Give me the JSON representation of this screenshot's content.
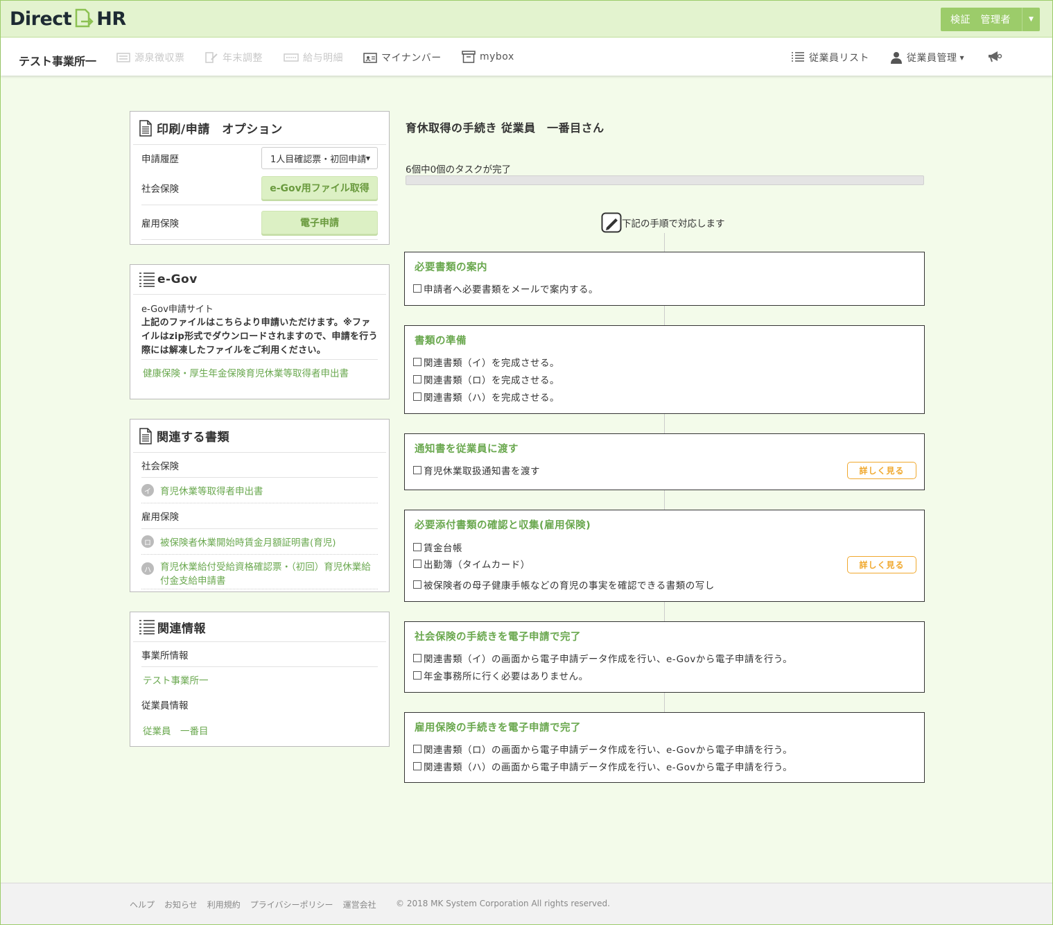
{
  "brand": {
    "logo_left": "Direct",
    "logo_right": "HR"
  },
  "header": {
    "user_label": "検証　管理者"
  },
  "nav": {
    "office": "テスト事業所一",
    "items": [
      "源泉徴収票",
      "年末調整",
      "給与明細",
      "マイナンバー",
      "mybox"
    ],
    "right": [
      "従業員リスト",
      "従業員管理"
    ]
  },
  "print_panel": {
    "title": "印刷/申請　オプション",
    "rows": [
      {
        "label": "申請履歴",
        "value": "1人目確認票・初回申請"
      },
      {
        "label": "社会保険",
        "value": "e-Gov用ファイル取得"
      },
      {
        "label": "雇用保険",
        "value": "電子申請"
      }
    ]
  },
  "egov_panel": {
    "title": "e-Gov",
    "site_label": "e-Gov申請サイト",
    "note": "上記のファイルはこちらより申請いただけます。※ファイルはzip形式でダウンロードされますので、申請を行う際には解凍したファイルをご利用ください。",
    "link": "健康保険・厚生年金保険育児休業等取得者申出書"
  },
  "docs_panel": {
    "title": "関連する書類",
    "section1": "社会保険",
    "doc1_badge": "イ",
    "doc1": "育児休業等取得者申出書",
    "section2": "雇用保険",
    "doc2_badge": "ロ",
    "doc2": "被保険者休業開始時賃金月額証明書(育児)",
    "doc3_badge": "ハ",
    "doc3": "育児休業給付受給資格確認票・（初回）育児休業給付金支給申請書"
  },
  "info_panel": {
    "title": "関連情報",
    "office_label": "事業所情報",
    "office_link": "テスト事業所一",
    "employee_label": "従業員情報",
    "employee_link": "従業員　一番目"
  },
  "main": {
    "title": "育休取得の手続き  従業員　一番目さん",
    "progress_text": "6個中0個のタスクが完了",
    "progress": 0,
    "instruction": "下記の手順で対応します",
    "detail_label": "詳しく見る",
    "tasks": [
      {
        "title": "必要書類の案内",
        "items": [
          "申請者へ必要書類をメールで案内する。"
        ]
      },
      {
        "title": "書類の準備",
        "items": [
          "関連書類（イ）を完成させる。",
          "関連書類（ロ）を完成させる。",
          "関連書類（ハ）を完成させる。"
        ]
      },
      {
        "title": "通知書を従業員に渡す",
        "items": [
          "育児休業取扱通知書を渡す"
        ]
      },
      {
        "title": "必要添付書類の確認と収集(雇用保険)",
        "items": [
          "賃金台帳",
          "出勤簿（タイムカード）",
          "被保険者の母子健康手帳などの育児の事実を確認できる書類の写し"
        ]
      },
      {
        "title": "社会保険の手続きを電子申請で完了",
        "items": [
          "関連書類（イ）の画面から電子申請データ作成を行い、e-Govから電子申請を行う。",
          "年金事務所に行く必要はありません。"
        ]
      },
      {
        "title": "雇用保険の手続きを電子申請で完了",
        "items": [
          "関連書類（ロ）の画面から電子申請データ作成を行い、e-Govから電子申請を行う。",
          "関連書類（ハ）の画面から電子申請データ作成を行い、e-Govから電子申請を行う。"
        ]
      }
    ]
  },
  "footer": {
    "links": [
      "ヘルプ",
      "お知らせ",
      "利用規約",
      "プライバシーポリシー",
      "運営会社"
    ],
    "copyright": "© 2018 MK System Corporation All rights reserved."
  }
}
